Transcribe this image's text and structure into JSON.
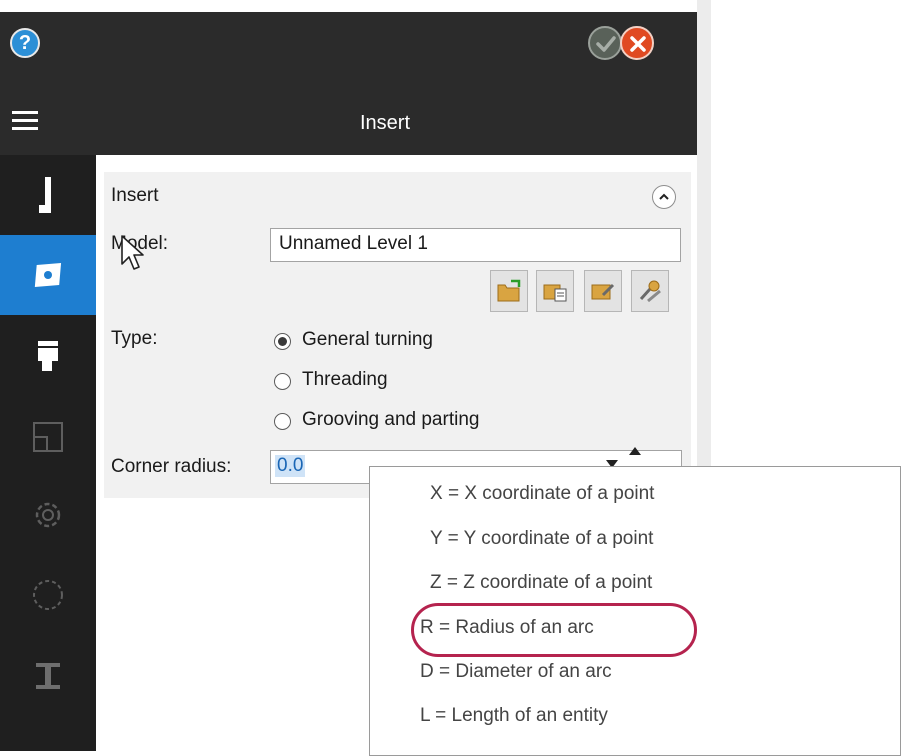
{
  "header": {
    "title": "Insert",
    "help_icon_glyph": "?",
    "accent_help": "#2c8fd6",
    "accent_cancel": "#e04a22"
  },
  "rail": {
    "items": [
      {
        "icon": "tool-holder-icon",
        "active": false
      },
      {
        "icon": "insert-icon",
        "active": true
      },
      {
        "icon": "tool-assembly-icon",
        "active": false
      },
      {
        "icon": "layout-icon",
        "active": false
      },
      {
        "icon": "gear-icon",
        "active": false
      },
      {
        "icon": "stock-icon",
        "active": false
      },
      {
        "icon": "fixture-icon",
        "active": false
      }
    ],
    "active_color": "#1e7ed0"
  },
  "insert": {
    "section_title": "Insert",
    "model_label": "Model:",
    "model_value": "Unnamed Level 1",
    "toolbar": [
      "open-folder-icon",
      "library-icon",
      "edit-model-icon",
      "settings-model-icon"
    ],
    "type_label": "Type:",
    "type_options": [
      {
        "label": "General turning",
        "checked": true
      },
      {
        "label": "Threading",
        "checked": false
      },
      {
        "label": "Grooving and parting",
        "checked": false
      }
    ],
    "corner_radius_label": "Corner radius:",
    "corner_radius_value": "0.0"
  },
  "dropdown": {
    "items": [
      "X  =  X coordinate of a point",
      "Y  =  Y coordinate of a point",
      "Z  =  Z coordinate of a point",
      "R  =  Radius of an arc",
      "D  =  Diameter of an arc",
      "L  =  Length of an entity"
    ],
    "highlighted_index": 3,
    "highlight_color": "#b5234e"
  }
}
